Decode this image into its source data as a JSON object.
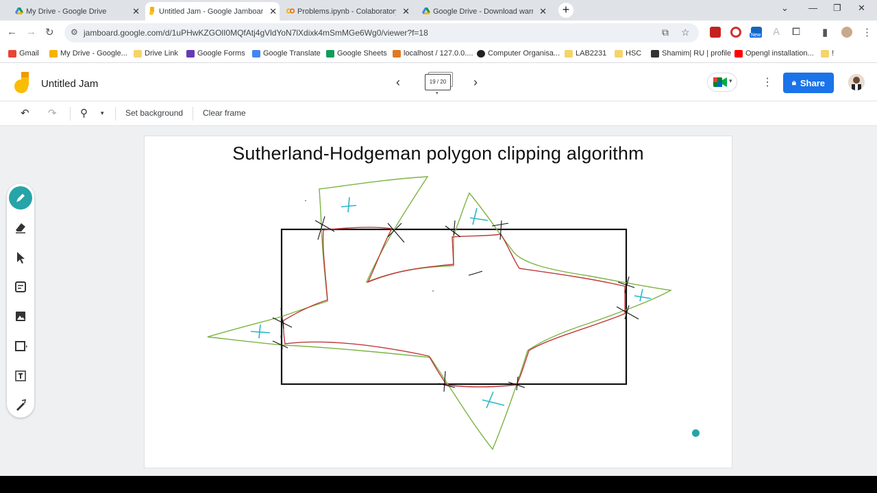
{
  "browser": {
    "tabs": [
      {
        "label": "My Drive - Google Drive",
        "icon": "google-drive-icon",
        "active": false
      },
      {
        "label": "Untitled Jam - Google Jamboard",
        "icon": "jamboard-icon",
        "active": true
      },
      {
        "label": "Problems.ipynb - Colaboratory",
        "icon": "colab-icon",
        "active": false
      },
      {
        "label": "Google Drive - Download warning",
        "icon": "google-drive-icon",
        "active": false
      }
    ],
    "url": "jamboard.google.com/d/1uPHwKZGOlI0MQfAtj4gVldYoN7lXdixk4mSmMGe6Wg0/viewer?f=18",
    "bookmarks": [
      {
        "label": "Gmail",
        "color": "#ea4335"
      },
      {
        "label": "My Drive - Google...",
        "color": "#f4b400"
      },
      {
        "label": "Drive Link",
        "color": "#f6d36b"
      },
      {
        "label": "Google Forms",
        "color": "#673ab7"
      },
      {
        "label": "Google Translate",
        "color": "#4285f4"
      },
      {
        "label": "Google Sheets",
        "color": "#0f9d58"
      },
      {
        "label": "localhost / 127.0.0....",
        "color": "#e07a1f"
      },
      {
        "label": "Computer Organisa...",
        "color": "#222222"
      },
      {
        "label": "LAB2231",
        "color": "#f6d36b"
      },
      {
        "label": "HSC",
        "color": "#f6d36b"
      },
      {
        "label": "Shamim| RU | profile",
        "color": "#333333"
      },
      {
        "label": "Opengl installation...",
        "color": "#ff0000"
      },
      {
        "label": "!",
        "color": "#f6d36b"
      }
    ],
    "ext_new_badge": "New"
  },
  "jamboard": {
    "title": "Untitled Jam",
    "frame_counter": "19 / 20",
    "share_label": "Share",
    "toolbar": {
      "set_background": "Set background",
      "clear_frame": "Clear frame"
    },
    "canvas_title": "Sutherland-Hodgeman polygon clipping algorithm"
  },
  "colors": {
    "accent": "#1a73e8",
    "pen_active": "#26a4a8",
    "green_stroke": "#7cb342",
    "red_stroke": "#c0393b",
    "cyan_mark": "#29b6c9",
    "clip_rect": "#111111"
  }
}
